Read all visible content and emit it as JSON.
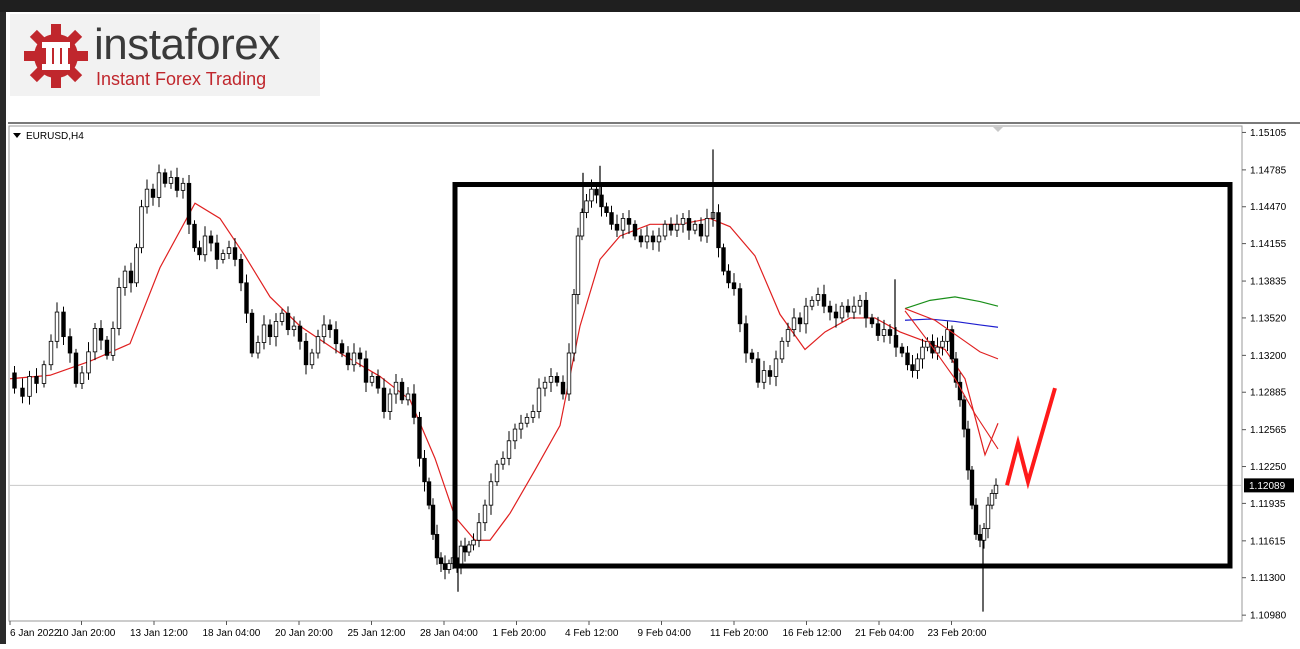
{
  "brand": {
    "name": "instaforex",
    "tagline": "Instant Forex Trading"
  },
  "chart_data": {
    "type": "candlestick",
    "symbol_label": "EURUSD,H4",
    "y_ticks": [
      1.15105,
      1.14785,
      1.1447,
      1.14155,
      1.13835,
      1.1352,
      1.132,
      1.12885,
      1.12565,
      1.1225,
      1.11935,
      1.11615,
      1.113,
      1.1098
    ],
    "ylim": [
      1.1093,
      1.1516
    ],
    "x_ticks": [
      "6 Jan 2022",
      "10 Jan 20:00",
      "13 Jan 12:00",
      "18 Jan 04:00",
      "20 Jan 20:00",
      "25 Jan 12:00",
      "28 Jan 04:00",
      "1 Feb 20:00",
      "4 Feb 12:00",
      "9 Feb 04:00",
      "11 Feb 20:00",
      "16 Feb 12:00",
      "21 Feb 04:00",
      "23 Feb 20:00"
    ],
    "current_price": 1.12089,
    "price_path": [
      [
        0,
        1.1305
      ],
      [
        9,
        1.1292
      ],
      [
        16,
        1.1285
      ],
      [
        23,
        1.1302
      ],
      [
        30,
        1.1296
      ],
      [
        38,
        1.1312
      ],
      [
        44,
        1.1332
      ],
      [
        50,
        1.1357
      ],
      [
        57,
        1.1336
      ],
      [
        63,
        1.1322
      ],
      [
        69,
        1.1296
      ],
      [
        75,
        1.1305
      ],
      [
        82,
        1.1323
      ],
      [
        88,
        1.1343
      ],
      [
        94,
        1.1333
      ],
      [
        100,
        1.132
      ],
      [
        106,
        1.1343
      ],
      [
        112,
        1.1378
      ],
      [
        118,
        1.1392
      ],
      [
        124,
        1.1382
      ],
      [
        129,
        1.1412
      ],
      [
        134,
        1.1447
      ],
      [
        140,
        1.1462
      ],
      [
        146,
        1.1455
      ],
      [
        152,
        1.1476
      ],
      [
        158,
        1.1467
      ],
      [
        164,
        1.1472
      ],
      [
        170,
        1.1461
      ],
      [
        176,
        1.1467
      ],
      [
        182,
        1.1432
      ],
      [
        187,
        1.1412
      ],
      [
        192,
        1.1406
      ],
      [
        198,
        1.1422
      ],
      [
        204,
        1.1416
      ],
      [
        210,
        1.1402
      ],
      [
        216,
        1.1407
      ],
      [
        222,
        1.1412
      ],
      [
        228,
        1.1402
      ],
      [
        234,
        1.1382
      ],
      [
        239,
        1.1356
      ],
      [
        245,
        1.1322
      ],
      [
        251,
        1.1331
      ],
      [
        257,
        1.1346
      ],
      [
        263,
        1.1336
      ],
      [
        269,
        1.1349
      ],
      [
        275,
        1.1356
      ],
      [
        281,
        1.1342
      ],
      [
        287,
        1.1345
      ],
      [
        293,
        1.1332
      ],
      [
        299,
        1.1312
      ],
      [
        305,
        1.1322
      ],
      [
        311,
        1.1336
      ],
      [
        317,
        1.1346
      ],
      [
        323,
        1.1342
      ],
      [
        329,
        1.133
      ],
      [
        335,
        1.1322
      ],
      [
        341,
        1.1312
      ],
      [
        347,
        1.1322
      ],
      [
        353,
        1.1317
      ],
      [
        359,
        1.1297
      ],
      [
        365,
        1.1302
      ],
      [
        371,
        1.1292
      ],
      [
        377,
        1.1272
      ],
      [
        383,
        1.1287
      ],
      [
        389,
        1.1297
      ],
      [
        395,
        1.1282
      ],
      [
        401,
        1.1287
      ],
      [
        407,
        1.1267
      ],
      [
        412,
        1.1232
      ],
      [
        417,
        1.1212
      ],
      [
        421,
        1.1192
      ],
      [
        425,
        1.1167
      ],
      [
        429,
        1.1147
      ],
      [
        433,
        1.1142
      ],
      [
        437,
        1.1137
      ],
      [
        441,
        1.1142
      ],
      [
        445,
        1.1147
      ],
      [
        449,
        1.114
      ],
      [
        453,
        1.1157
      ],
      [
        457,
        1.1152
      ],
      [
        461,
        1.1158
      ],
      [
        466,
        1.1162
      ],
      [
        472,
        1.1177
      ],
      [
        478,
        1.1192
      ],
      [
        484,
        1.1212
      ],
      [
        490,
        1.1227
      ],
      [
        496,
        1.1232
      ],
      [
        502,
        1.1247
      ],
      [
        508,
        1.1257
      ],
      [
        514,
        1.1262
      ],
      [
        520,
        1.1267
      ],
      [
        526,
        1.1272
      ],
      [
        532,
        1.1292
      ],
      [
        538,
        1.1297
      ],
      [
        544,
        1.1302
      ],
      [
        550,
        1.1297
      ],
      [
        556,
        1.1287
      ],
      [
        562,
        1.1322
      ],
      [
        566,
        1.1372
      ],
      [
        570,
        1.1422
      ],
      [
        574,
        1.1442
      ],
      [
        579,
        1.1452
      ],
      [
        584,
        1.1462
      ],
      [
        589,
        1.1457
      ],
      [
        594,
        1.1447
      ],
      [
        599,
        1.1442
      ],
      [
        604,
        1.1432
      ],
      [
        610,
        1.1427
      ],
      [
        616,
        1.1437
      ],
      [
        622,
        1.1432
      ],
      [
        628,
        1.1422
      ],
      [
        634,
        1.1417
      ],
      [
        640,
        1.1422
      ],
      [
        646,
        1.1417
      ],
      [
        652,
        1.1422
      ],
      [
        658,
        1.1432
      ],
      [
        664,
        1.1427
      ],
      [
        670,
        1.1432
      ],
      [
        676,
        1.1437
      ],
      [
        682,
        1.1427
      ],
      [
        688,
        1.1432
      ],
      [
        694,
        1.1422
      ],
      [
        700,
        1.1437
      ],
      [
        706,
        1.1442
      ],
      [
        711,
        1.1412
      ],
      [
        716,
        1.1392
      ],
      [
        721,
        1.1382
      ],
      [
        727,
        1.1377
      ],
      [
        733,
        1.1347
      ],
      [
        739,
        1.1322
      ],
      [
        745,
        1.1317
      ],
      [
        751,
        1.1297
      ],
      [
        757,
        1.1307
      ],
      [
        763,
        1.1302
      ],
      [
        769,
        1.1317
      ],
      [
        775,
        1.1332
      ],
      [
        781,
        1.1342
      ],
      [
        787,
        1.1352
      ],
      [
        793,
        1.1347
      ],
      [
        799,
        1.1362
      ],
      [
        805,
        1.1367
      ],
      [
        811,
        1.1372
      ],
      [
        817,
        1.1362
      ],
      [
        823,
        1.1357
      ],
      [
        829,
        1.1352
      ],
      [
        835,
        1.1362
      ],
      [
        841,
        1.1357
      ],
      [
        847,
        1.1362
      ],
      [
        853,
        1.1367
      ],
      [
        859,
        1.1352
      ],
      [
        865,
        1.1347
      ],
      [
        871,
        1.1337
      ],
      [
        877,
        1.1342
      ],
      [
        883,
        1.1337
      ],
      [
        889,
        1.1327
      ],
      [
        895,
        1.1322
      ],
      [
        900,
        1.1312
      ],
      [
        905,
        1.1307
      ],
      [
        910,
        1.1317
      ],
      [
        915,
        1.1327
      ],
      [
        920,
        1.1332
      ],
      [
        925,
        1.1322
      ],
      [
        930,
        1.1327
      ],
      [
        935,
        1.1332
      ],
      [
        940,
        1.1342
      ],
      [
        944,
        1.1317
      ],
      [
        948,
        1.1297
      ],
      [
        952,
        1.1282
      ],
      [
        956,
        1.1257
      ],
      [
        960,
        1.1222
      ],
      [
        964,
        1.1192
      ],
      [
        968,
        1.1167
      ],
      [
        972,
        1.1162
      ],
      [
        976,
        1.1172
      ],
      [
        980,
        1.1192
      ],
      [
        984,
        1.1202
      ],
      [
        988,
        1.1209
      ]
    ],
    "wicks": [
      [
        573,
        1.1476
      ],
      [
        590,
        1.1482
      ],
      [
        703,
        1.1496
      ],
      [
        973,
        1.1101
      ],
      [
        885,
        1.1385
      ],
      [
        448,
        1.1118
      ]
    ],
    "ma_red": [
      [
        0,
        1.13
      ],
      [
        40,
        1.1303
      ],
      [
        80,
        1.1315
      ],
      [
        120,
        1.133
      ],
      [
        150,
        1.1395
      ],
      [
        185,
        1.145
      ],
      [
        210,
        1.1437
      ],
      [
        235,
        1.1405
      ],
      [
        260,
        1.137
      ],
      [
        290,
        1.1345
      ],
      [
        330,
        1.1322
      ],
      [
        370,
        1.1302
      ],
      [
        400,
        1.1282
      ],
      [
        425,
        1.1232
      ],
      [
        445,
        1.1182
      ],
      [
        465,
        1.1162
      ],
      [
        480,
        1.1162
      ],
      [
        500,
        1.1185
      ],
      [
        525,
        1.1222
      ],
      [
        550,
        1.126
      ],
      [
        570,
        1.1345
      ],
      [
        590,
        1.1402
      ],
      [
        610,
        1.1422
      ],
      [
        640,
        1.1432
      ],
      [
        670,
        1.1432
      ],
      [
        700,
        1.1437
      ],
      [
        720,
        1.143
      ],
      [
        745,
        1.1405
      ],
      [
        770,
        1.1355
      ],
      [
        795,
        1.1325
      ],
      [
        815,
        1.134
      ],
      [
        840,
        1.1352
      ],
      [
        865,
        1.1352
      ],
      [
        890,
        1.134
      ],
      [
        915,
        1.1332
      ],
      [
        935,
        1.1325
      ],
      [
        955,
        1.13
      ],
      [
        975,
        1.1235
      ],
      [
        988,
        1.1262
      ]
    ],
    "projection": {
      "green": [
        [
          895,
          1.136
        ],
        [
          920,
          1.1367
        ],
        [
          945,
          1.137
        ],
        [
          970,
          1.1366
        ],
        [
          988,
          1.1362
        ]
      ],
      "blue": [
        [
          895,
          1.135
        ],
        [
          920,
          1.1351
        ],
        [
          945,
          1.1349
        ],
        [
          970,
          1.1346
        ],
        [
          988,
          1.1344
        ]
      ],
      "red1": [
        [
          895,
          1.136
        ],
        [
          925,
          1.135
        ],
        [
          950,
          1.1335
        ],
        [
          970,
          1.1323
        ],
        [
          988,
          1.1317
        ]
      ],
      "red2": [
        [
          895,
          1.1358
        ],
        [
          920,
          1.133
        ],
        [
          945,
          1.13
        ],
        [
          965,
          1.127
        ],
        [
          988,
          1.124
        ]
      ]
    },
    "box": {
      "x_start": 445,
      "x_end": 1220,
      "y_top": 1.1466,
      "y_bottom": 1.114
    },
    "forecast_arrow": [
      [
        997,
        1.1209
      ],
      [
        1008,
        1.1245
      ],
      [
        1018,
        1.1212
      ],
      [
        1045,
        1.1292
      ]
    ],
    "colors": {
      "candle": "#000000",
      "ma": "#e02020",
      "box": "#000000",
      "arrow": "#ff1a1a",
      "green": "#1a8f1a",
      "blue": "#1e1ecf",
      "grid": "#c8c8c8"
    }
  }
}
